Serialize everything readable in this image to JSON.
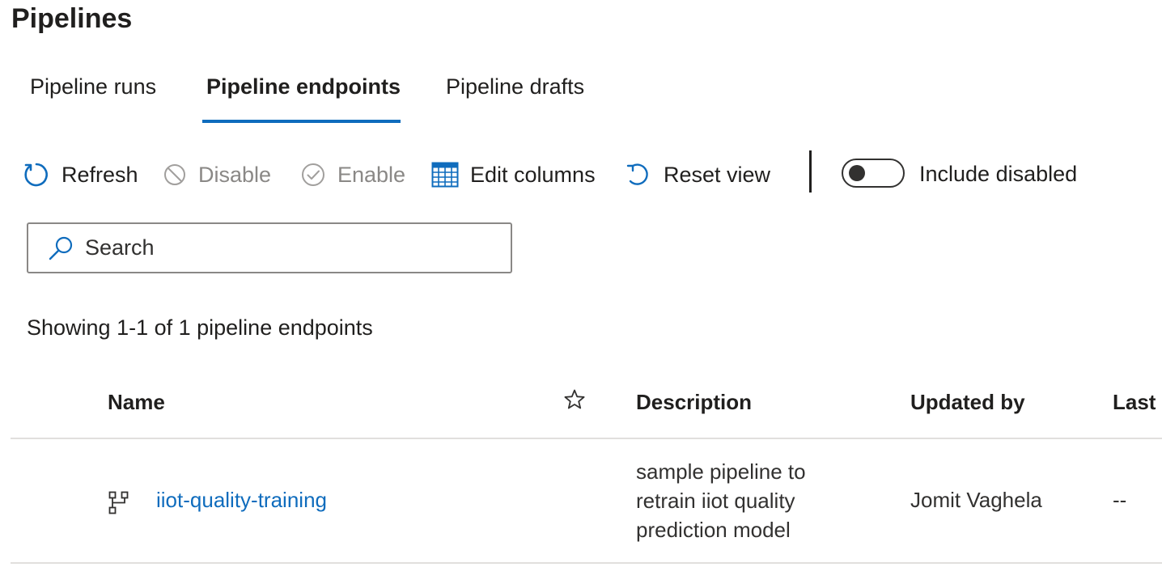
{
  "page": {
    "title": "Pipelines"
  },
  "tabs": [
    {
      "label": "Pipeline runs",
      "active": false
    },
    {
      "label": "Pipeline endpoints",
      "active": true
    },
    {
      "label": "Pipeline drafts",
      "active": false
    }
  ],
  "toolbar": {
    "refresh": {
      "label": "Refresh",
      "icon": "refresh-icon",
      "enabled": true
    },
    "disable": {
      "label": "Disable",
      "icon": "blocked-icon",
      "enabled": false
    },
    "enable": {
      "label": "Enable",
      "icon": "check-circle-icon",
      "enabled": false
    },
    "edit_columns": {
      "label": "Edit columns",
      "icon": "table-columns-icon",
      "enabled": true
    },
    "reset_view": {
      "label": "Reset view",
      "icon": "undo-icon",
      "enabled": true
    },
    "include_disabled": {
      "label": "Include disabled",
      "checked": false
    }
  },
  "search": {
    "placeholder": "Search",
    "value": ""
  },
  "results": {
    "summary": "Showing 1-1 of 1 pipeline endpoints"
  },
  "table": {
    "columns": [
      "Name",
      "Description",
      "Updated by",
      "Last r"
    ],
    "favorite_icon": "star-outline-icon",
    "rows": [
      {
        "name": "iiot-quality-training",
        "icon": "pipeline-icon",
        "description": "sample pipeline to retrain iiot quality prediction model",
        "updated_by": "Jomit Vaghela",
        "last": "--"
      }
    ]
  },
  "colors": {
    "accent": "#0f6cbd",
    "text": "#201f1e",
    "disabled": "#8a8886",
    "border": "#e1dfdd"
  }
}
